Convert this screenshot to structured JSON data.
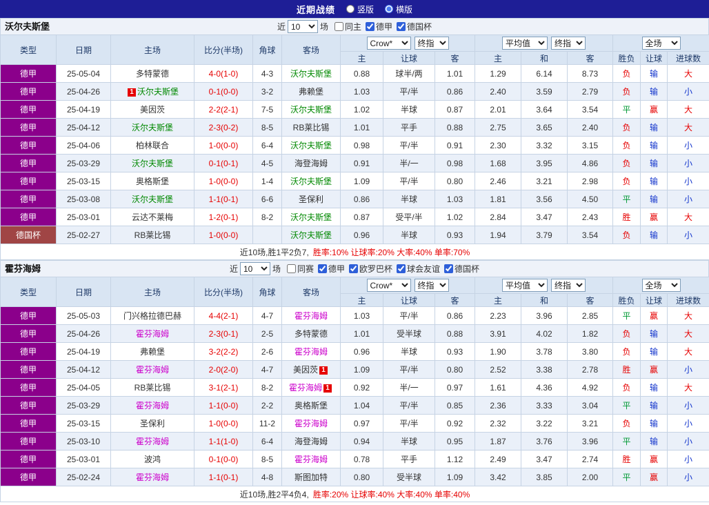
{
  "colors": {
    "topbar-bg": "#1E1E96",
    "header-bg": "#D9E5F3",
    "header-text": "#1F3A68",
    "filter-bg": "#EEF2F9",
    "stripe-bg": "#EAF0F9",
    "grid-border": "#C6D3E4",
    "score-red": "#E60000",
    "badge-red": "#E60000"
  },
  "topbar": {
    "title": "近期战绩",
    "radios": [
      {
        "label": "竖版",
        "checked": false
      },
      {
        "label": "横版",
        "checked": true
      }
    ]
  },
  "filter_labels": {
    "near": "近",
    "matches": "场"
  },
  "columns": {
    "type": "类型",
    "date": "日期",
    "home": "主场",
    "score": "比分(半场)",
    "corner": "角球",
    "away": "客场",
    "odds_company": "Crow*",
    "odds_stage": "终指",
    "odds_sub": [
      "主",
      "让球",
      "客"
    ],
    "avg_label": "平均值",
    "avg_stage": "终指",
    "avg_sub": [
      "主",
      "和",
      "客"
    ],
    "scope_label": "全场",
    "result_sub": [
      "胜负",
      "让球",
      "进球数"
    ]
  },
  "league_colors": {
    "德甲": "#8B008B",
    "德国杯": "#A04545"
  },
  "result_colors": {
    "胜": "#E60000",
    "平": "#009933",
    "负": "#E60000",
    "赢": "#E60000",
    "输": "#1133CC",
    "大": "#E60000",
    "小": "#1133CC"
  },
  "sections": [
    {
      "team": "沃尔夫斯堡",
      "team_color": "#008800",
      "filter": {
        "count": "10",
        "checkboxes": [
          {
            "label": "同主",
            "checked": false
          },
          {
            "label": "德甲",
            "checked": true
          },
          {
            "label": "德国杯",
            "checked": true
          }
        ]
      },
      "rows": [
        {
          "league": "德甲",
          "date": "25-05-04",
          "home": {
            "name": "多特蒙德",
            "hl": false
          },
          "score": "4-0(1-0)",
          "corner": "4-3",
          "away": {
            "name": "沃尔夫斯堡",
            "hl": true
          },
          "odds": [
            "0.88",
            "球半/两",
            "1.01"
          ],
          "avg": [
            "1.29",
            "6.14",
            "8.73"
          ],
          "results": [
            "负",
            "输",
            "大"
          ]
        },
        {
          "league": "德甲",
          "date": "25-04-26",
          "home": {
            "name": "沃尔夫斯堡",
            "hl": true,
            "badge": "1",
            "badge_side": "left"
          },
          "score": "0-1(0-0)",
          "corner": "3-2",
          "away": {
            "name": "弗赖堡",
            "hl": false
          },
          "odds": [
            "1.03",
            "平/半",
            "0.86"
          ],
          "avg": [
            "2.40",
            "3.59",
            "2.79"
          ],
          "results": [
            "负",
            "输",
            "小"
          ]
        },
        {
          "league": "德甲",
          "date": "25-04-19",
          "home": {
            "name": "美因茨",
            "hl": false
          },
          "score": "2-2(2-1)",
          "corner": "7-5",
          "away": {
            "name": "沃尔夫斯堡",
            "hl": true
          },
          "odds": [
            "1.02",
            "半球",
            "0.87"
          ],
          "avg": [
            "2.01",
            "3.64",
            "3.54"
          ],
          "results": [
            "平",
            "赢",
            "大"
          ]
        },
        {
          "league": "德甲",
          "date": "25-04-12",
          "home": {
            "name": "沃尔夫斯堡",
            "hl": true
          },
          "score": "2-3(0-2)",
          "corner": "8-5",
          "away": {
            "name": "RB莱比锡",
            "hl": false
          },
          "odds": [
            "1.01",
            "平手",
            "0.88"
          ],
          "avg": [
            "2.75",
            "3.65",
            "2.40"
          ],
          "results": [
            "负",
            "输",
            "大"
          ]
        },
        {
          "league": "德甲",
          "date": "25-04-06",
          "home": {
            "name": "柏林联合",
            "hl": false
          },
          "score": "1-0(0-0)",
          "corner": "6-4",
          "away": {
            "name": "沃尔夫斯堡",
            "hl": true
          },
          "odds": [
            "0.98",
            "平/半",
            "0.91"
          ],
          "avg": [
            "2.30",
            "3.32",
            "3.15"
          ],
          "results": [
            "负",
            "输",
            "小"
          ]
        },
        {
          "league": "德甲",
          "date": "25-03-29",
          "home": {
            "name": "沃尔夫斯堡",
            "hl": true
          },
          "score": "0-1(0-1)",
          "corner": "4-5",
          "away": {
            "name": "海登海姆",
            "hl": false
          },
          "odds": [
            "0.91",
            "半/一",
            "0.98"
          ],
          "avg": [
            "1.68",
            "3.95",
            "4.86"
          ],
          "results": [
            "负",
            "输",
            "小"
          ]
        },
        {
          "league": "德甲",
          "date": "25-03-15",
          "home": {
            "name": "奥格斯堡",
            "hl": false
          },
          "score": "1-0(0-0)",
          "corner": "1-4",
          "away": {
            "name": "沃尔夫斯堡",
            "hl": true
          },
          "odds": [
            "1.09",
            "平/半",
            "0.80"
          ],
          "avg": [
            "2.46",
            "3.21",
            "2.98"
          ],
          "results": [
            "负",
            "输",
            "小"
          ]
        },
        {
          "league": "德甲",
          "date": "25-03-08",
          "home": {
            "name": "沃尔夫斯堡",
            "hl": true
          },
          "score": "1-1(0-1)",
          "corner": "6-6",
          "away": {
            "name": "圣保利",
            "hl": false
          },
          "odds": [
            "0.86",
            "半球",
            "1.03"
          ],
          "avg": [
            "1.81",
            "3.56",
            "4.50"
          ],
          "results": [
            "平",
            "输",
            "小"
          ]
        },
        {
          "league": "德甲",
          "date": "25-03-01",
          "home": {
            "name": "云达不莱梅",
            "hl": false
          },
          "score": "1-2(0-1)",
          "corner": "8-2",
          "away": {
            "name": "沃尔夫斯堡",
            "hl": true
          },
          "odds": [
            "0.87",
            "受平/半",
            "1.02"
          ],
          "avg": [
            "2.84",
            "3.47",
            "2.43"
          ],
          "results": [
            "胜",
            "赢",
            "大"
          ]
        },
        {
          "league": "德国杯",
          "date": "25-02-27",
          "home": {
            "name": "RB莱比锡",
            "hl": false
          },
          "score": "1-0(0-0)",
          "corner": "",
          "away": {
            "name": "沃尔夫斯堡",
            "hl": true
          },
          "odds": [
            "0.96",
            "半球",
            "0.93"
          ],
          "avg": [
            "1.94",
            "3.79",
            "3.54"
          ],
          "results": [
            "负",
            "输",
            "小"
          ]
        }
      ],
      "summary": {
        "prefix": "近10场,胜1平2负7,",
        "stats": "胜率:10% 让球率:20% 大率:40% 单率:70%"
      }
    },
    {
      "team": "霍芬海姆",
      "team_color": "#CC00CC",
      "filter": {
        "count": "10",
        "checkboxes": [
          {
            "label": "同赛",
            "checked": false
          },
          {
            "label": "德甲",
            "checked": true
          },
          {
            "label": "欧罗巴杯",
            "checked": true
          },
          {
            "label": "球会友谊",
            "checked": true
          },
          {
            "label": "德国杯",
            "checked": true
          }
        ]
      },
      "rows": [
        {
          "league": "德甲",
          "date": "25-05-03",
          "home": {
            "name": "门兴格拉德巴赫",
            "hl": false
          },
          "score": "4-4(2-1)",
          "corner": "4-7",
          "away": {
            "name": "霍芬海姆",
            "hl": true
          },
          "odds": [
            "1.03",
            "平/半",
            "0.86"
          ],
          "avg": [
            "2.23",
            "3.96",
            "2.85"
          ],
          "results": [
            "平",
            "赢",
            "大"
          ]
        },
        {
          "league": "德甲",
          "date": "25-04-26",
          "home": {
            "name": "霍芬海姆",
            "hl": true
          },
          "score": "2-3(0-1)",
          "corner": "2-5",
          "away": {
            "name": "多特蒙德",
            "hl": false
          },
          "odds": [
            "1.01",
            "受半球",
            "0.88"
          ],
          "avg": [
            "3.91",
            "4.02",
            "1.82"
          ],
          "results": [
            "负",
            "输",
            "大"
          ]
        },
        {
          "league": "德甲",
          "date": "25-04-19",
          "home": {
            "name": "弗赖堡",
            "hl": false
          },
          "score": "3-2(2-2)",
          "corner": "2-6",
          "away": {
            "name": "霍芬海姆",
            "hl": true
          },
          "odds": [
            "0.96",
            "半球",
            "0.93"
          ],
          "avg": [
            "1.90",
            "3.78",
            "3.80"
          ],
          "results": [
            "负",
            "输",
            "大"
          ]
        },
        {
          "league": "德甲",
          "date": "25-04-12",
          "home": {
            "name": "霍芬海姆",
            "hl": true
          },
          "score": "2-0(2-0)",
          "corner": "4-7",
          "away": {
            "name": "美因茨",
            "hl": false,
            "badge": "1",
            "badge_side": "right"
          },
          "odds": [
            "1.09",
            "平/半",
            "0.80"
          ],
          "avg": [
            "2.52",
            "3.38",
            "2.78"
          ],
          "results": [
            "胜",
            "赢",
            "小"
          ]
        },
        {
          "league": "德甲",
          "date": "25-04-05",
          "home": {
            "name": "RB莱比锡",
            "hl": false
          },
          "score": "3-1(2-1)",
          "corner": "8-2",
          "away": {
            "name": "霍芬海姆",
            "hl": true,
            "badge": "1",
            "badge_side": "right"
          },
          "odds": [
            "0.92",
            "半/一",
            "0.97"
          ],
          "avg": [
            "1.61",
            "4.36",
            "4.92"
          ],
          "results": [
            "负",
            "输",
            "大"
          ]
        },
        {
          "league": "德甲",
          "date": "25-03-29",
          "home": {
            "name": "霍芬海姆",
            "hl": true
          },
          "score": "1-1(0-0)",
          "corner": "2-2",
          "away": {
            "name": "奥格斯堡",
            "hl": false
          },
          "odds": [
            "1.04",
            "平/半",
            "0.85"
          ],
          "avg": [
            "2.36",
            "3.33",
            "3.04"
          ],
          "results": [
            "平",
            "输",
            "小"
          ]
        },
        {
          "league": "德甲",
          "date": "25-03-15",
          "home": {
            "name": "圣保利",
            "hl": false
          },
          "score": "1-0(0-0)",
          "corner": "11-2",
          "away": {
            "name": "霍芬海姆",
            "hl": true
          },
          "odds": [
            "0.97",
            "平/半",
            "0.92"
          ],
          "avg": [
            "2.32",
            "3.22",
            "3.21"
          ],
          "results": [
            "负",
            "输",
            "小"
          ]
        },
        {
          "league": "德甲",
          "date": "25-03-10",
          "home": {
            "name": "霍芬海姆",
            "hl": true
          },
          "score": "1-1(1-0)",
          "corner": "6-4",
          "away": {
            "name": "海登海姆",
            "hl": false
          },
          "odds": [
            "0.94",
            "半球",
            "0.95"
          ],
          "avg": [
            "1.87",
            "3.76",
            "3.96"
          ],
          "results": [
            "平",
            "输",
            "小"
          ]
        },
        {
          "league": "德甲",
          "date": "25-03-01",
          "home": {
            "name": "波鸿",
            "hl": false
          },
          "score": "0-1(0-0)",
          "corner": "8-5",
          "away": {
            "name": "霍芬海姆",
            "hl": true
          },
          "odds": [
            "0.78",
            "平手",
            "1.12"
          ],
          "avg": [
            "2.49",
            "3.47",
            "2.74"
          ],
          "results": [
            "胜",
            "赢",
            "小"
          ]
        },
        {
          "league": "德甲",
          "date": "25-02-24",
          "home": {
            "name": "霍芬海姆",
            "hl": true
          },
          "score": "1-1(0-1)",
          "corner": "4-8",
          "away": {
            "name": "斯图加特",
            "hl": false
          },
          "odds": [
            "0.80",
            "受半球",
            "1.09"
          ],
          "avg": [
            "3.42",
            "3.85",
            "2.00"
          ],
          "results": [
            "平",
            "赢",
            "小"
          ]
        }
      ],
      "summary": {
        "prefix": "近10场,胜2平4负4,",
        "stats": "胜率:20% 让球率:40% 大率:40% 单率:40%"
      }
    }
  ]
}
